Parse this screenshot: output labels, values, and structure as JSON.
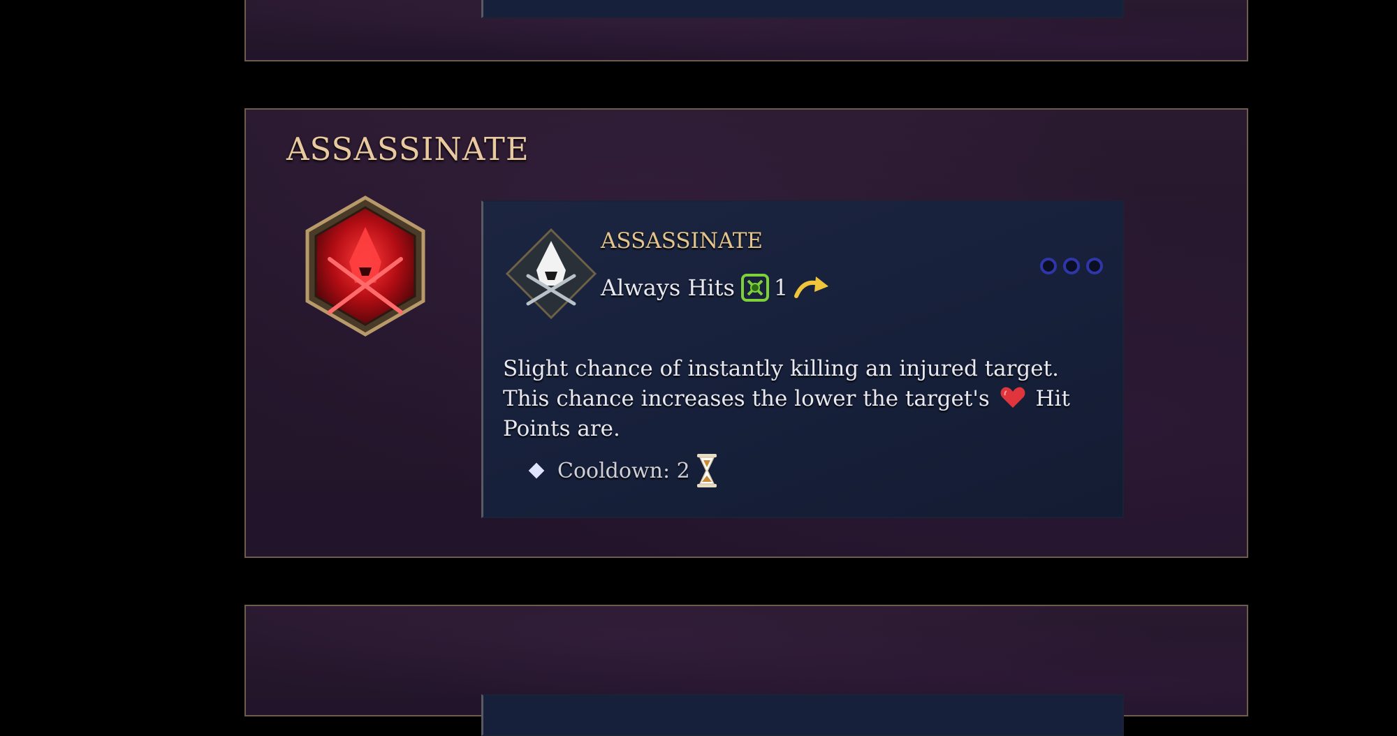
{
  "section": {
    "title": "ASSASSINATE",
    "icon": "hooded-assassin-crossed-blades-icon"
  },
  "tooltip": {
    "name": "ASSASSINATE",
    "emblem": "hooded-assassin-emblem-icon",
    "hit_label": "Always Hits",
    "hit_icon": "target-crosshair-icon",
    "range_value": "1",
    "range_icon": "curved-arrow-icon",
    "pips": [
      "empty-pip",
      "empty-pip",
      "empty-pip"
    ],
    "description_part1": "Slight chance of instantly killing an injured target. This chance increases the lower the target's",
    "description_icon": "heart-icon",
    "description_part2": "Hit Points are.",
    "cooldown_label": "Cooldown: 2",
    "cooldown_icon": "hourglass-icon"
  },
  "colors": {
    "title_gold": "#e9c9a0",
    "name_gold": "#e3c48c",
    "panel_purple": "#24162b",
    "tooltip_navy": "#17203a",
    "pip_blue": "#2f36a8",
    "target_green": "#7fd13a",
    "arrow_yellow": "#f0c53c"
  }
}
